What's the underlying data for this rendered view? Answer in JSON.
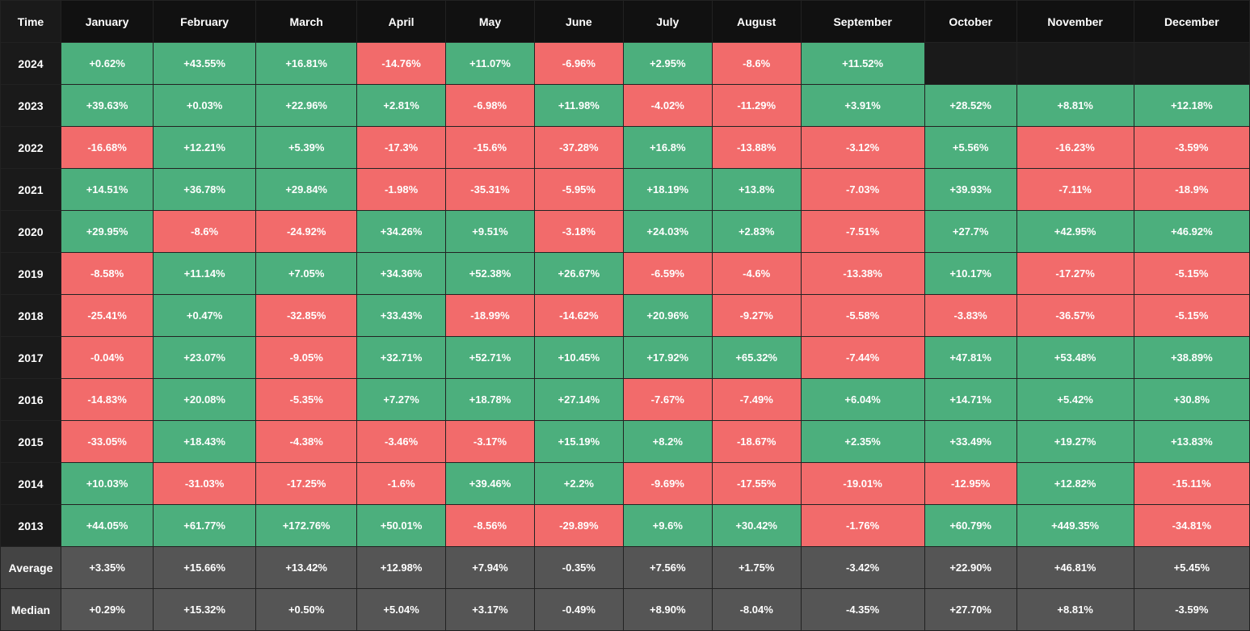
{
  "headers": [
    "Time",
    "January",
    "February",
    "March",
    "April",
    "May",
    "June",
    "July",
    "August",
    "September",
    "October",
    "November",
    "December"
  ],
  "rows": [
    {
      "year": "2024",
      "cells": [
        "+0.62%",
        "+43.55%",
        "+16.81%",
        "-14.76%",
        "+11.07%",
        "-6.96%",
        "+2.95%",
        "-8.6%",
        "+11.52%",
        "",
        "",
        ""
      ]
    },
    {
      "year": "2023",
      "cells": [
        "+39.63%",
        "+0.03%",
        "+22.96%",
        "+2.81%",
        "-6.98%",
        "+11.98%",
        "-4.02%",
        "-11.29%",
        "+3.91%",
        "+28.52%",
        "+8.81%",
        "+12.18%"
      ]
    },
    {
      "year": "2022",
      "cells": [
        "-16.68%",
        "+12.21%",
        "+5.39%",
        "-17.3%",
        "-15.6%",
        "-37.28%",
        "+16.8%",
        "-13.88%",
        "-3.12%",
        "+5.56%",
        "-16.23%",
        "-3.59%"
      ]
    },
    {
      "year": "2021",
      "cells": [
        "+14.51%",
        "+36.78%",
        "+29.84%",
        "-1.98%",
        "-35.31%",
        "-5.95%",
        "+18.19%",
        "+13.8%",
        "-7.03%",
        "+39.93%",
        "-7.11%",
        "-18.9%"
      ]
    },
    {
      "year": "2020",
      "cells": [
        "+29.95%",
        "-8.6%",
        "-24.92%",
        "+34.26%",
        "+9.51%",
        "-3.18%",
        "+24.03%",
        "+2.83%",
        "-7.51%",
        "+27.7%",
        "+42.95%",
        "+46.92%"
      ]
    },
    {
      "year": "2019",
      "cells": [
        "-8.58%",
        "+11.14%",
        "+7.05%",
        "+34.36%",
        "+52.38%",
        "+26.67%",
        "-6.59%",
        "-4.6%",
        "-13.38%",
        "+10.17%",
        "-17.27%",
        "-5.15%"
      ]
    },
    {
      "year": "2018",
      "cells": [
        "-25.41%",
        "+0.47%",
        "-32.85%",
        "+33.43%",
        "-18.99%",
        "-14.62%",
        "+20.96%",
        "-9.27%",
        "-5.58%",
        "-3.83%",
        "-36.57%",
        "-5.15%"
      ]
    },
    {
      "year": "2017",
      "cells": [
        "-0.04%",
        "+23.07%",
        "-9.05%",
        "+32.71%",
        "+52.71%",
        "+10.45%",
        "+17.92%",
        "+65.32%",
        "-7.44%",
        "+47.81%",
        "+53.48%",
        "+38.89%"
      ]
    },
    {
      "year": "2016",
      "cells": [
        "-14.83%",
        "+20.08%",
        "-5.35%",
        "+7.27%",
        "+18.78%",
        "+27.14%",
        "-7.67%",
        "-7.49%",
        "+6.04%",
        "+14.71%",
        "+5.42%",
        "+30.8%"
      ]
    },
    {
      "year": "2015",
      "cells": [
        "-33.05%",
        "+18.43%",
        "-4.38%",
        "-3.46%",
        "-3.17%",
        "+15.19%",
        "+8.2%",
        "-18.67%",
        "+2.35%",
        "+33.49%",
        "+19.27%",
        "+13.83%"
      ]
    },
    {
      "year": "2014",
      "cells": [
        "+10.03%",
        "-31.03%",
        "-17.25%",
        "-1.6%",
        "+39.46%",
        "+2.2%",
        "-9.69%",
        "-17.55%",
        "-19.01%",
        "-12.95%",
        "+12.82%",
        "-15.11%"
      ]
    },
    {
      "year": "2013",
      "cells": [
        "+44.05%",
        "+61.77%",
        "+172.76%",
        "+50.01%",
        "-8.56%",
        "-29.89%",
        "+9.6%",
        "+30.42%",
        "-1.76%",
        "+60.79%",
        "+449.35%",
        "-34.81%"
      ]
    }
  ],
  "average": {
    "label": "Average",
    "cells": [
      "+3.35%",
      "+15.66%",
      "+13.42%",
      "+12.98%",
      "+7.94%",
      "-0.35%",
      "+7.56%",
      "+1.75%",
      "-3.42%",
      "+22.90%",
      "+46.81%",
      "+5.45%"
    ]
  },
  "median": {
    "label": "Median",
    "cells": [
      "+0.29%",
      "+15.32%",
      "+0.50%",
      "+5.04%",
      "+3.17%",
      "-0.49%",
      "+8.90%",
      "-8.04%",
      "-4.35%",
      "+27.70%",
      "+8.81%",
      "-3.59%"
    ]
  }
}
